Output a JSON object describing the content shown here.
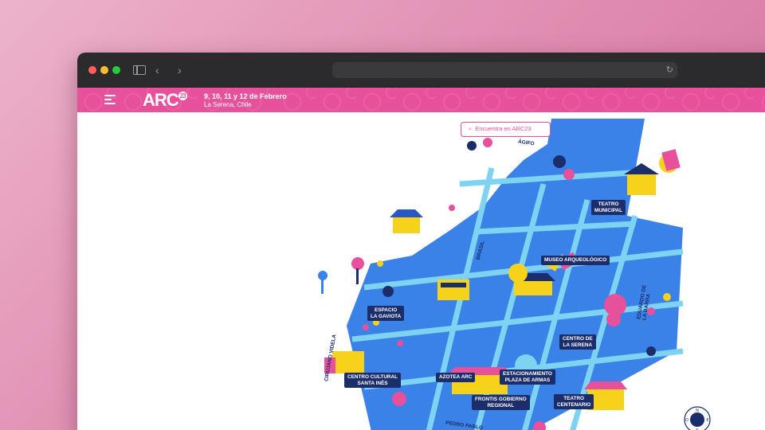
{
  "browser": {
    "url": "",
    "reload_icon": "reload-icon",
    "back_icon": "chevron-left-icon",
    "forward_icon": "chevron-right-icon"
  },
  "site": {
    "logo": "ARC",
    "logo_badge": "23",
    "dates": "9, 10, 11 y 12 de Febrero",
    "city": "La Serena, Chile",
    "brand_color": "#e7509a"
  },
  "search": {
    "placeholder": "Encuentra en ARC23"
  },
  "map": {
    "colors": {
      "blocks": "#3b82e8",
      "streets": "#7fd3f2",
      "labels": "#1b2d6b"
    },
    "places": [
      {
        "id": "teatro-municipal",
        "label": "TEATRO\nMUNICIPAL"
      },
      {
        "id": "museo-arqueologico",
        "label": "MUSEO ARQUEOLÓGICO"
      },
      {
        "id": "espacio-la-gaviota",
        "label": "ESPACIO\nLA GAVIOTA"
      },
      {
        "id": "centro-de-la-serena",
        "label": "CENTRO DE\nLA SERENA"
      },
      {
        "id": "centro-cultural-santa-ines",
        "label": "CENTRO CULTURAL\nSANTA INÉS"
      },
      {
        "id": "azotea-arc",
        "label": "AZOTEA ARC"
      },
      {
        "id": "estacionamiento-plaza-de-armas",
        "label": "ESTACIONAMIENTO\nPLAZA DE ARMAS"
      },
      {
        "id": "teatro-centenario",
        "label": "TEATRO\nCENTENARIO"
      },
      {
        "id": "frontis-gobierno-regional",
        "label": "FRONTIS GOBIERNO\nREGIONAL"
      }
    ],
    "streets": [
      {
        "id": "brasil",
        "label": "BRASIL"
      },
      {
        "id": "cirujano-videla",
        "label": "CIRUJANO VIDELA"
      },
      {
        "id": "eduardo-de-la-barra",
        "label": "EDUARDO DE\nLA BARRA"
      },
      {
        "id": "pedro-pablo",
        "label": "PEDRO PABLO"
      },
      {
        "id": "arqueologico-top",
        "label": "ÁGIFO"
      }
    ],
    "compass_letters": [
      "N",
      "E",
      "S",
      "O"
    ]
  }
}
